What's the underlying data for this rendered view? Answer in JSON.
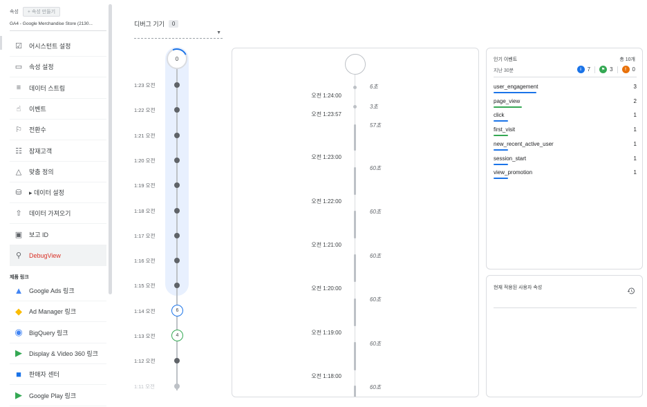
{
  "sidebar": {
    "property_label": "속성",
    "create_property": "+  속성 만들기",
    "property_name": "GA4 - Google Merchandise Store (2130...",
    "items": [
      {
        "label": "어시스턴트 설정",
        "icon": "checkbox-icon"
      },
      {
        "label": "속성 설정",
        "icon": "window-icon"
      },
      {
        "label": "데이터 스트림",
        "icon": "streams-icon"
      },
      {
        "label": "이벤트",
        "icon": "touch-icon"
      },
      {
        "label": "전환수",
        "icon": "flag-icon"
      },
      {
        "label": "잠재고객",
        "icon": "audience-icon"
      },
      {
        "label": "맞춤 정의",
        "icon": "shapes-icon"
      },
      {
        "label": "▸ 데이터 설정",
        "icon": "database-icon"
      },
      {
        "label": "데이터 가져오기",
        "icon": "upload-icon"
      },
      {
        "label": "보고 ID",
        "icon": "id-icon"
      },
      {
        "label": "DebugView",
        "icon": "debug-icon"
      }
    ],
    "product_links_label": "제품 링크",
    "product_links": [
      {
        "label": "Google Ads 링크",
        "icon": "google-ads-icon"
      },
      {
        "label": "Ad Manager 링크",
        "icon": "ad-manager-icon"
      },
      {
        "label": "BigQuery 링크",
        "icon": "bigquery-icon"
      },
      {
        "label": "Display & Video 360 링크",
        "icon": "dv360-icon"
      },
      {
        "label": "판매자 센터",
        "icon": "merchant-center-icon"
      },
      {
        "label": "Google Play 링크",
        "icon": "google-play-icon"
      }
    ]
  },
  "debug": {
    "device_label": "디버그 기기",
    "device_count": "0"
  },
  "minutes": {
    "top_count": "0",
    "rows": [
      {
        "time": "1:23 오전",
        "badge": ""
      },
      {
        "time": "1:22 오전",
        "badge": ""
      },
      {
        "time": "1:21 오전",
        "badge": ""
      },
      {
        "time": "1:20 오전",
        "badge": ""
      },
      {
        "time": "1:19 오전",
        "badge": ""
      },
      {
        "time": "1:18 오전",
        "badge": ""
      },
      {
        "time": "1:17 오전",
        "badge": ""
      },
      {
        "time": "1:16 오전",
        "badge": ""
      },
      {
        "time": "1:15 오전",
        "badge": ""
      },
      {
        "time": "1:14 오전",
        "badge": "6"
      },
      {
        "time": "1:13 오전",
        "badge": "4"
      },
      {
        "time": "1:12 오전",
        "badge": ""
      },
      {
        "time": "1:11 오전",
        "badge": ""
      }
    ]
  },
  "stream": {
    "times": [
      "오전 1:24:00",
      "오전 1:23:57",
      "오전 1:23:00",
      "오전 1:22:00",
      "오전 1:21:00",
      "오전 1:20:00",
      "오전 1:19:00",
      "오전 1:18:00"
    ],
    "seconds": [
      "6초",
      "3초",
      "57초",
      "60초",
      "60초",
      "60초",
      "60초",
      "60초",
      "60초"
    ]
  },
  "top_events": {
    "title": "인기 이벤트",
    "total": "총 10개",
    "period": "지난 30분",
    "stats": [
      {
        "icon": "info-icon",
        "value": "7",
        "color": "#1a73e8"
      },
      {
        "icon": "flag-icon",
        "value": "3",
        "color": "#34a853"
      },
      {
        "icon": "error-icon",
        "value": "0",
        "color": "#e8710a"
      }
    ],
    "rows": [
      {
        "name": "user_engagement",
        "count": "3",
        "color": "#1a73e8",
        "share": 0.3
      },
      {
        "name": "page_view",
        "count": "2",
        "color": "#34a853",
        "share": 0.2
      },
      {
        "name": "click",
        "count": "1",
        "color": "#1a73e8",
        "share": 0.1
      },
      {
        "name": "first_visit",
        "count": "1",
        "color": "#34a853",
        "share": 0.1
      },
      {
        "name": "new_recent_active_user",
        "count": "1",
        "color": "#1a73e8",
        "share": 0.1
      },
      {
        "name": "session_start",
        "count": "1",
        "color": "#1a73e8",
        "share": 0.1
      },
      {
        "name": "view_promotion",
        "count": "1",
        "color": "#1a73e8",
        "share": 0.1
      }
    ]
  },
  "user_properties": {
    "title": "현재 적용된 사용자 속성",
    "icon": "history-icon"
  }
}
